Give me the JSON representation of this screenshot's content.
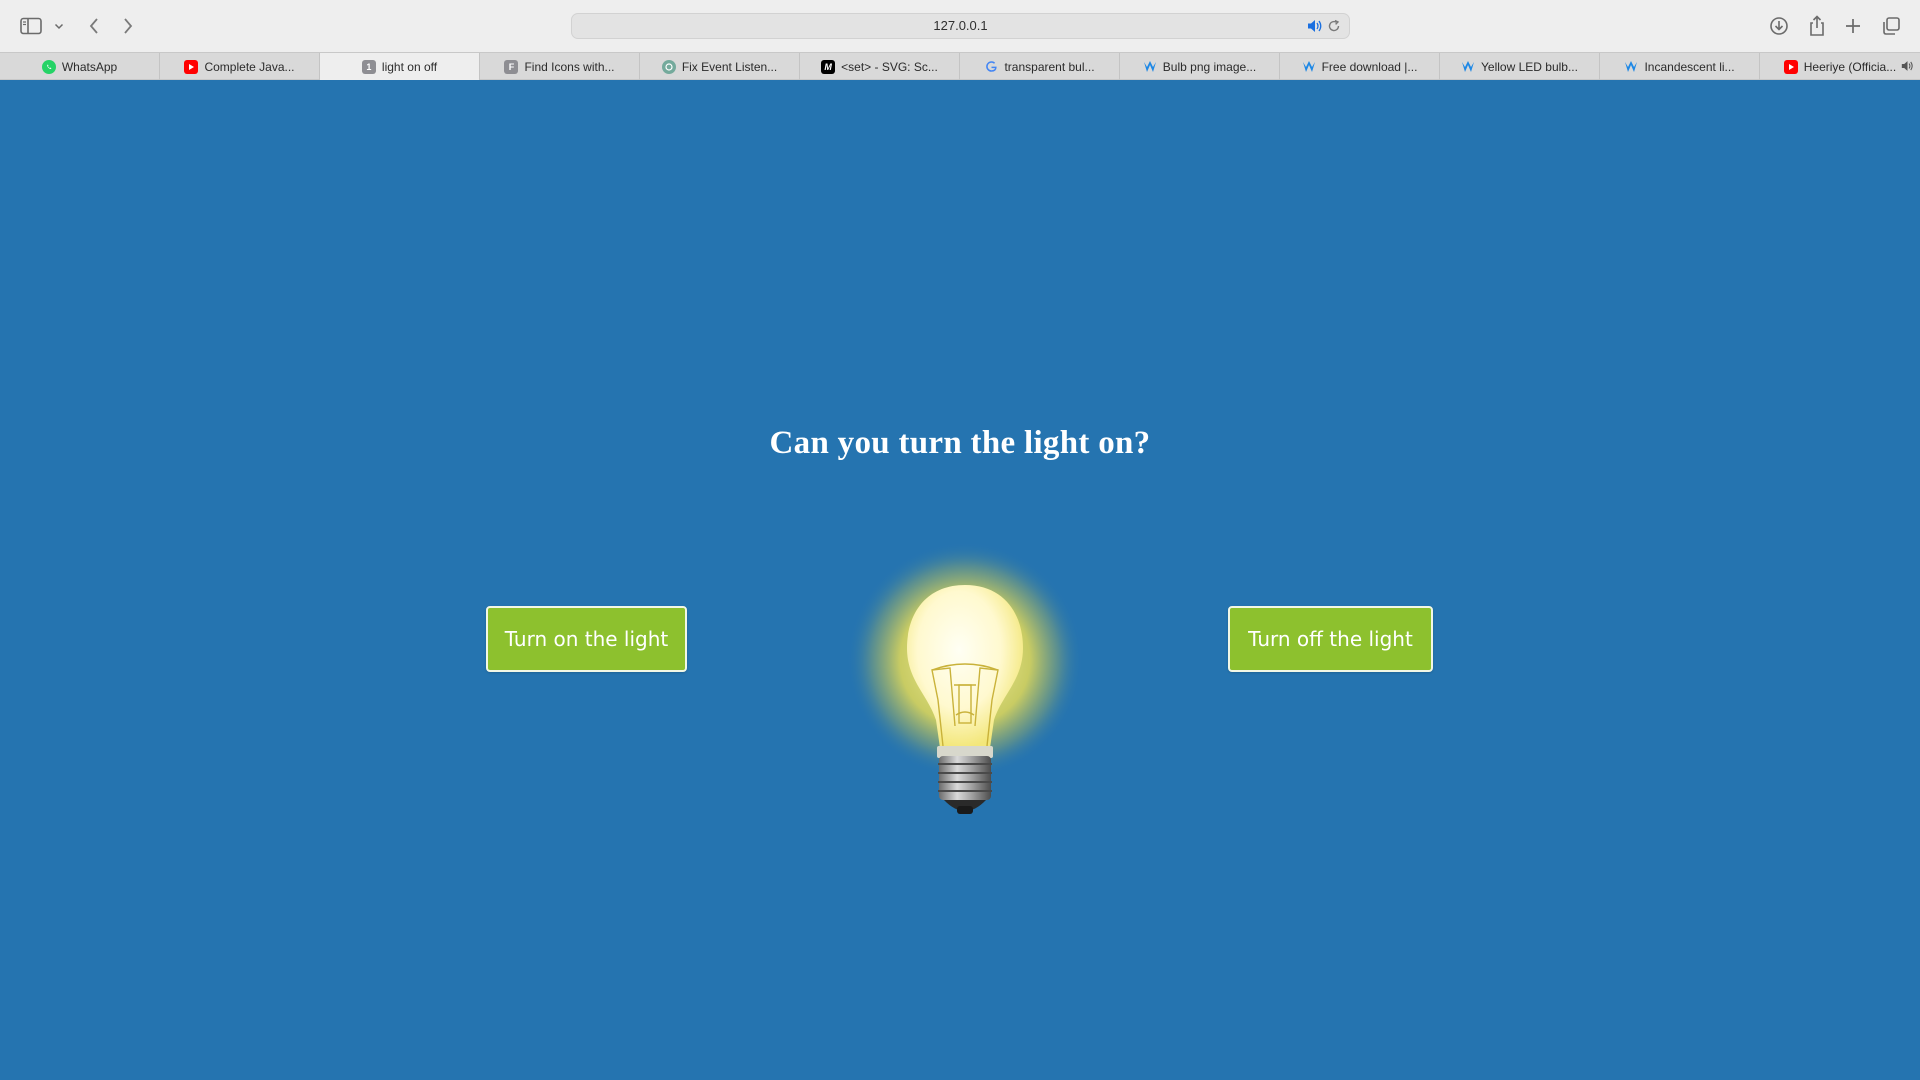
{
  "browser": {
    "url": "127.0.0.1",
    "tabs": [
      {
        "label": "WhatsApp",
        "icon": "whatsapp-icon",
        "color": "#25d366"
      },
      {
        "label": "Complete Java...",
        "icon": "youtube-icon",
        "color": "#ff0000"
      },
      {
        "label": "light on off",
        "icon": "page-number-icon",
        "color": "#8e8e93",
        "active": true
      },
      {
        "label": "Find Icons with...",
        "icon": "f-letter-icon",
        "color": "#8e8e93"
      },
      {
        "label": "Fix Event Listen...",
        "icon": "chatgpt-icon",
        "color": "#74aa9c"
      },
      {
        "label": "<set> - SVG: Sc...",
        "icon": "mdn-icon",
        "color": "#000000"
      },
      {
        "label": "transparent bul...",
        "icon": "google-icon",
        "color": "#4285f4"
      },
      {
        "label": "Bulb png image...",
        "icon": "wing-logo-icon",
        "color": "#1e88e5"
      },
      {
        "label": "Free download |...",
        "icon": "wing-logo-icon",
        "color": "#1e88e5"
      },
      {
        "label": "Yellow LED bulb...",
        "icon": "wing-logo-icon",
        "color": "#1e88e5"
      },
      {
        "label": "Incandescent li...",
        "icon": "wing-logo-icon",
        "color": "#1e88e5"
      },
      {
        "label": "Heeriye (Officia...",
        "icon": "youtube-icon",
        "color": "#ff0000"
      }
    ],
    "active_tab_favicon_text": "1",
    "mdn_favicon_text": "M",
    "f_favicon_text": "F"
  },
  "page": {
    "title": "Can you turn the light on?",
    "button_on": "Turn on the light",
    "button_off": "Turn off the light",
    "bulb_state": "on"
  },
  "colors": {
    "background": "#2574b0",
    "button": "#8dc12e",
    "glow": "#ffe94a"
  }
}
